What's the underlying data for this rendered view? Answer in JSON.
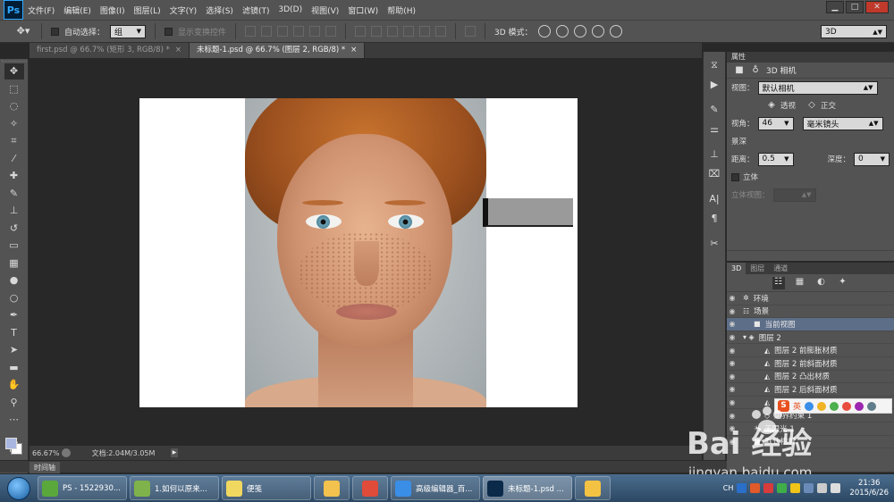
{
  "menubar": {
    "logo": "Ps",
    "items": [
      "文件(F)",
      "编辑(E)",
      "图像(I)",
      "图层(L)",
      "文字(Y)",
      "选择(S)",
      "滤镜(T)",
      "3D(D)",
      "视图(V)",
      "窗口(W)",
      "帮助(H)"
    ],
    "window_controls": [
      "▁",
      "□",
      "✕"
    ]
  },
  "optbar": {
    "auto_select_label": "自动选择：",
    "auto_select_value": "组",
    "show_transform_label": "显示变换控件",
    "mode3d_label": "3D 模式：",
    "workspace": "3D"
  },
  "doctabs": [
    {
      "title": "first.psd @ 66.7% (矩形 3, RGB/8) *",
      "close": "×",
      "active": false
    },
    {
      "title": "未标题-1.psd @ 66.7% (图层 2, RGB/8) *",
      "close": "×",
      "active": true
    }
  ],
  "statusbar": {
    "zoom": "66.67%",
    "doc_info": "文档:2.04M/3.05M",
    "arrow": "▶"
  },
  "timeline": {
    "label": "时间轴"
  },
  "properties": {
    "header": "属性",
    "title": "3D 相机",
    "view_label": "视图：",
    "view_value": "默认相机",
    "perspective": "透视",
    "orthographic": "正交",
    "fov_label": "视角：",
    "fov_value": "46",
    "lens_value": "毫米镜头",
    "dof_label": "景深",
    "distance_label": "距离：",
    "distance_value": "0.5",
    "depth_label": "深度：",
    "depth_value": "0",
    "stereo_label": "立体",
    "stereo_view_label": "立体视图："
  },
  "layers": {
    "tabs": [
      "3D",
      "图层",
      "通道"
    ],
    "rows": [
      {
        "label": "环境",
        "indent": 0,
        "icon": "✲"
      },
      {
        "label": "场景",
        "indent": 0,
        "icon": "☷"
      },
      {
        "label": "当前视图",
        "indent": 1,
        "icon": "■",
        "selected": true
      },
      {
        "label": "图层 2",
        "indent": 0,
        "icon": "▾ ◈"
      },
      {
        "label": "图层 2 前膨胀材质",
        "indent": 2,
        "icon": "◭"
      },
      {
        "label": "图层 2 前斜面材质",
        "indent": 2,
        "icon": "◭"
      },
      {
        "label": "图层 2 凸出材质",
        "indent": 2,
        "icon": "◭"
      },
      {
        "label": "图层 2 后斜面材质",
        "indent": 2,
        "icon": "◭"
      },
      {
        "label": "图层 2 后膨胀材质",
        "indent": 2,
        "icon": "◭"
      },
      {
        "label": "边界约束 1",
        "indent": 2,
        "icon": "◇"
      },
      {
        "label": "无限光 1",
        "indent": 1,
        "icon": "☀"
      },
      {
        "label": "默认相机",
        "indent": 1,
        "icon": "■"
      }
    ]
  },
  "ime": {
    "brand": "S",
    "mode": "英"
  },
  "watermark": {
    "brand": "Bai 经验",
    "url": "jingyan.baidu.com"
  },
  "taskbar": {
    "tasks": [
      {
        "label": "PS - 1522930...",
        "color": "#5aa83c"
      },
      {
        "label": "1.如何以原来...",
        "color": "#7fb24a"
      },
      {
        "label": "便笺",
        "color": "#f0d860"
      },
      {
        "label": "",
        "color": "#f2c14e",
        "pin": true
      },
      {
        "label": "",
        "color": "#e04b3a",
        "pin": true
      },
      {
        "label": "高级编辑器_百...",
        "color": "#3a8ee6"
      },
      {
        "label": "未标题-1.psd ...",
        "color": "#0b2a4a",
        "active": true
      },
      {
        "label": "",
        "color": "#f4c242",
        "pin": true
      }
    ],
    "lang": "CH",
    "time": "21:36",
    "date": "2015/6/26"
  }
}
